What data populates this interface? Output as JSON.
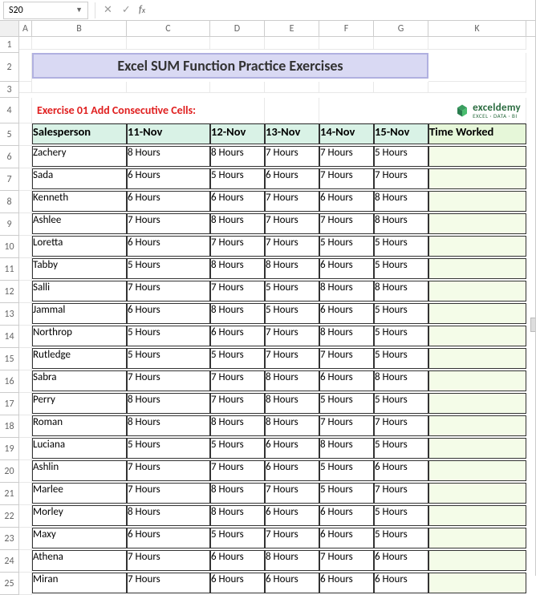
{
  "namebox": "S20",
  "formula": "",
  "columns": [
    "A",
    "B",
    "C",
    "D",
    "E",
    "F",
    "G",
    "K"
  ],
  "title": "Excel SUM Function Practice Exercises",
  "exercise": "Exercise 01 Add Consecutive Cells:",
  "logo": {
    "name": "exceldemy",
    "tagline": "EXCEL · DATA · BI"
  },
  "headers": [
    "Salesperson",
    "11-Nov",
    "12-Nov",
    "13-Nov",
    "14-Nov",
    "15-Nov",
    "Time Worked"
  ],
  "chart_data": {
    "type": "table",
    "title": "Excel SUM Function Practice Exercises",
    "columns": [
      "Salesperson",
      "11-Nov",
      "12-Nov",
      "13-Nov",
      "14-Nov",
      "15-Nov",
      "Time Worked"
    ],
    "rows": [
      [
        "Zachery",
        "8 Hours",
        "8 Hours",
        "7 Hours",
        "7 Hours",
        "5 Hours",
        ""
      ],
      [
        "Sada",
        "6 Hours",
        "5 Hours",
        "6 Hours",
        "7 Hours",
        "7 Hours",
        ""
      ],
      [
        "Kenneth",
        "6 Hours",
        "6 Hours",
        "7 Hours",
        "6 Hours",
        "8 Hours",
        ""
      ],
      [
        "Ashlee",
        "7 Hours",
        "8 Hours",
        "7 Hours",
        "7 Hours",
        "8 Hours",
        ""
      ],
      [
        "Loretta",
        "6 Hours",
        "7 Hours",
        "7 Hours",
        "5 Hours",
        "5 Hours",
        ""
      ],
      [
        "Tabby",
        "5 Hours",
        "8 Hours",
        "8 Hours",
        "6 Hours",
        "5 Hours",
        ""
      ],
      [
        "Salli",
        "7 Hours",
        "7 Hours",
        "5 Hours",
        "8 Hours",
        "8 Hours",
        ""
      ],
      [
        "Jammal",
        "6 Hours",
        "8 Hours",
        "5 Hours",
        "6 Hours",
        "5 Hours",
        ""
      ],
      [
        "Northrop",
        "5 Hours",
        "6 Hours",
        "7 Hours",
        "8 Hours",
        "5 Hours",
        ""
      ],
      [
        "Rutledge",
        "5 Hours",
        "5 Hours",
        "7 Hours",
        "7 Hours",
        "5 Hours",
        ""
      ],
      [
        "Sabra",
        "7 Hours",
        "7 Hours",
        "8 Hours",
        "6 Hours",
        "8 Hours",
        ""
      ],
      [
        "Perry",
        "8 Hours",
        "7 Hours",
        "8 Hours",
        "5 Hours",
        "5 Hours",
        ""
      ],
      [
        "Roman",
        "8 Hours",
        "8 Hours",
        "8 Hours",
        "7 Hours",
        "7 Hours",
        ""
      ],
      [
        "Luciana",
        "5 Hours",
        "5 Hours",
        "6 Hours",
        "8 Hours",
        "5 Hours",
        ""
      ],
      [
        "Ashlin",
        "7 Hours",
        "7 Hours",
        "6 Hours",
        "5 Hours",
        "6 Hours",
        ""
      ],
      [
        "Marlee",
        "7 Hours",
        "8 Hours",
        "7 Hours",
        "5 Hours",
        "7 Hours",
        ""
      ],
      [
        "Morley",
        "8 Hours",
        "8 Hours",
        "6 Hours",
        "6 Hours",
        "5 Hours",
        ""
      ],
      [
        "Maxy",
        "6 Hours",
        "5 Hours",
        "7 Hours",
        "6 Hours",
        "5 Hours",
        ""
      ],
      [
        "Athena",
        "7 Hours",
        "6 Hours",
        "8 Hours",
        "7 Hours",
        "6 Hours",
        ""
      ],
      [
        "Miran",
        "7 Hours",
        "6 Hours",
        "6 Hours",
        "6 Hours",
        "6 Hours",
        ""
      ]
    ]
  }
}
